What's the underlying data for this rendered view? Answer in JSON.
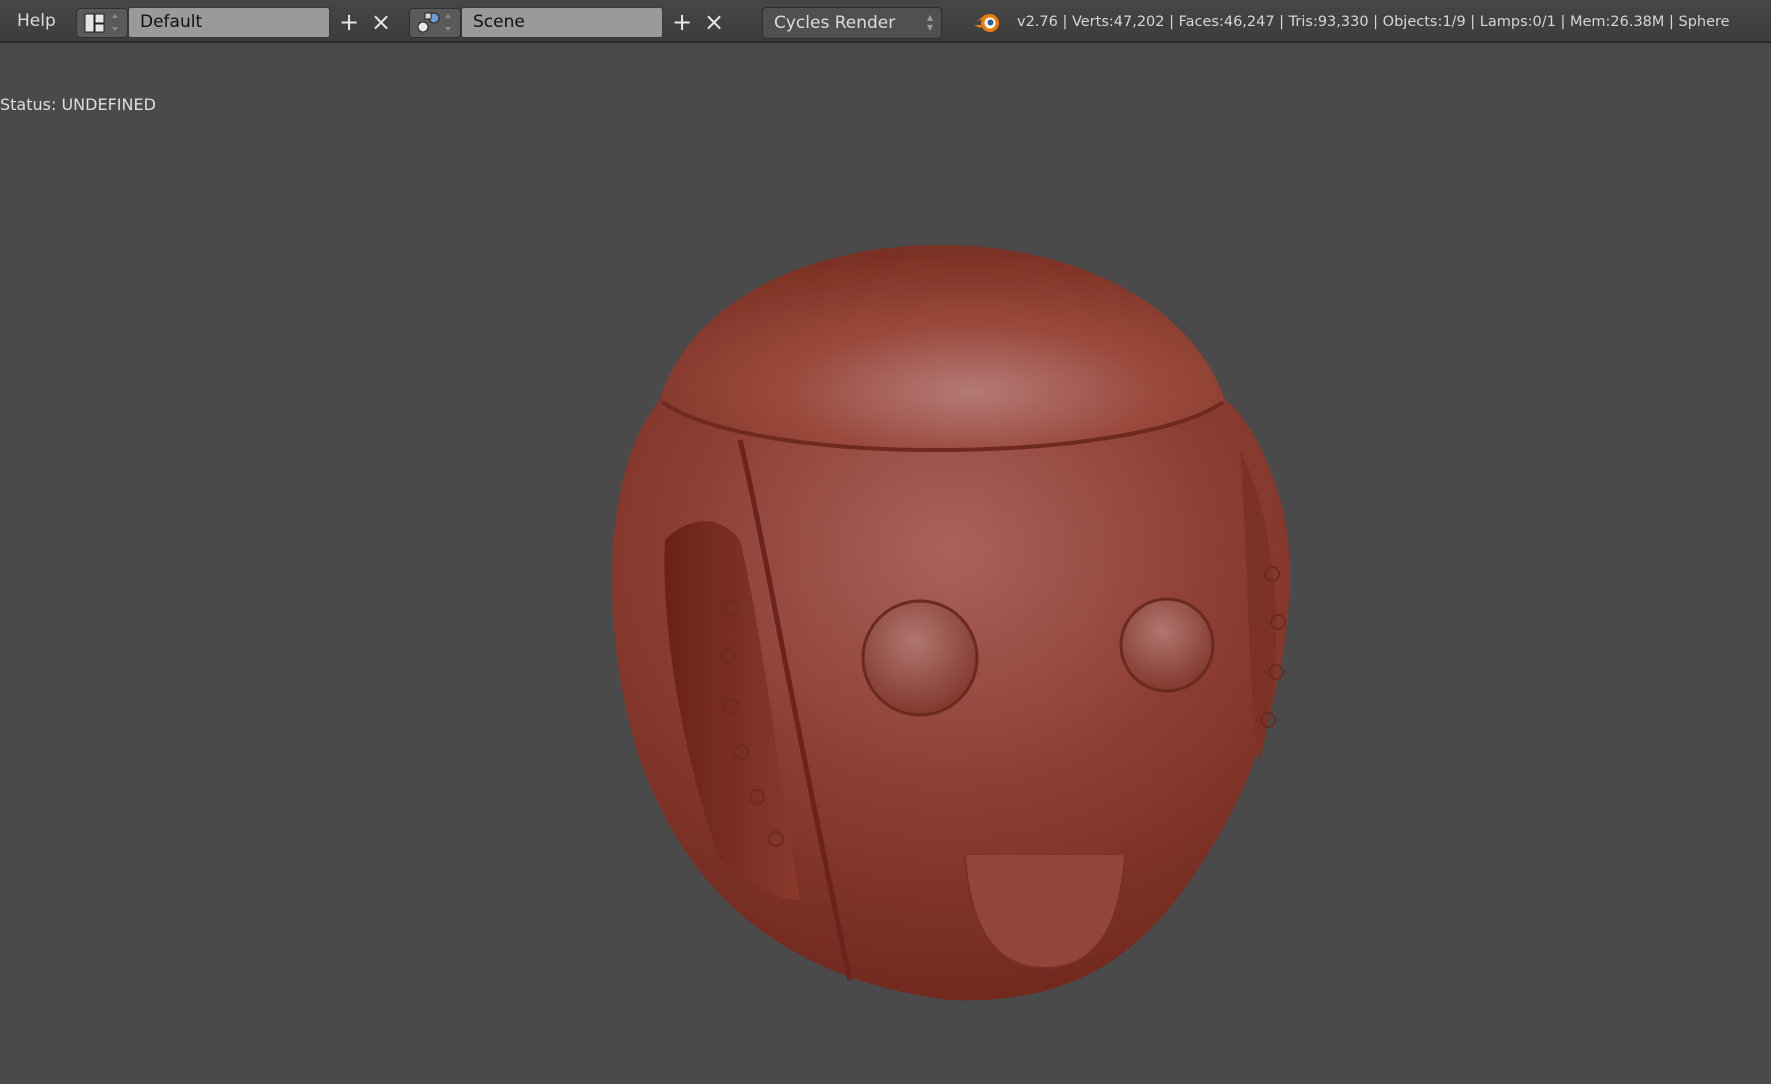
{
  "menu": {
    "help_label": "Help"
  },
  "screen_layout": {
    "value": "Default",
    "icon": "screen-layout-icon"
  },
  "scene": {
    "value": "Scene",
    "icon": "scene-icon"
  },
  "buttons": {
    "add_symbol": "+",
    "remove_symbol": "×"
  },
  "render_engine": {
    "value": "Cycles Render"
  },
  "stats": {
    "text": "v2.76 | Verts:47,202 | Faces:46,247 | Tris:93,330 | Objects:1/9 | Lamps:0/1 | Mem:26.38M | Sphere"
  },
  "viewport": {
    "status_text": "Status: UNDEFINED"
  },
  "colors": {
    "header_bg": "#3d3d3d",
    "viewport_bg": "#4a4a4a",
    "field_bg": "#9a9a9a",
    "model_base": "#8e3a2e",
    "model_highlight": "#b87a74",
    "blender_logo": "#e87d0d"
  }
}
